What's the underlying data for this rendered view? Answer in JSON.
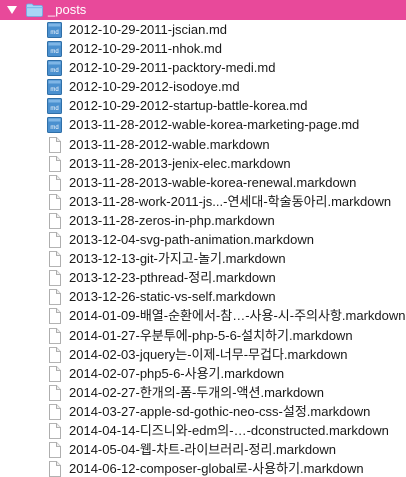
{
  "folder": {
    "name": "_posts",
    "expanded": true,
    "selection_color": "#e8499a"
  },
  "files": [
    {
      "name": "2012-10-29-2011-jscian.md",
      "icon": "markdown-file-icon"
    },
    {
      "name": "2012-10-29-2011-nhok.md",
      "icon": "markdown-file-icon"
    },
    {
      "name": "2012-10-29-2011-packtory-medi.md",
      "icon": "markdown-file-icon"
    },
    {
      "name": "2012-10-29-2012-isodoye.md",
      "icon": "markdown-file-icon"
    },
    {
      "name": "2012-10-29-2012-startup-battle-korea.md",
      "icon": "markdown-file-icon"
    },
    {
      "name": "2013-11-28-2012-wable-korea-marketing-page.md",
      "icon": "markdown-file-icon"
    },
    {
      "name": "2013-11-28-2012-wable.markdown",
      "icon": "document-icon"
    },
    {
      "name": "2013-11-28-2013-jenix-elec.markdown",
      "icon": "document-icon"
    },
    {
      "name": "2013-11-28-2013-wable-korea-renewal.markdown",
      "icon": "document-icon"
    },
    {
      "name": "2013-11-28-work-2011-js...-연세대-학술동아리.markdown",
      "icon": "document-icon"
    },
    {
      "name": "2013-11-28-zeros-in-php.markdown",
      "icon": "document-icon"
    },
    {
      "name": "2013-12-04-svg-path-animation.markdown",
      "icon": "document-icon"
    },
    {
      "name": "2013-12-13-git-가지고-놀기.markdown",
      "icon": "document-icon"
    },
    {
      "name": "2013-12-23-pthread-정리.markdown",
      "icon": "document-icon"
    },
    {
      "name": "2013-12-26-static-vs-self.markdown",
      "icon": "document-icon"
    },
    {
      "name": "2014-01-09-배열-순환에서-참…-사용-시-주의사항.markdown",
      "icon": "document-icon"
    },
    {
      "name": "2014-01-27-우분투에-php-5-6-설치하기.markdown",
      "icon": "document-icon"
    },
    {
      "name": "2014-02-03-jquery는-이제-너무-무겁다.markdown",
      "icon": "document-icon"
    },
    {
      "name": "2014-02-07-php5-6-사용기.markdown",
      "icon": "document-icon"
    },
    {
      "name": "2014-02-27-한개의-폼-두개의-액션.markdown",
      "icon": "document-icon"
    },
    {
      "name": "2014-03-27-apple-sd-gothic-neo-css-설정.markdown",
      "icon": "document-icon"
    },
    {
      "name": "2014-04-14-디즈니와-edm의-…-dconstructed.markdown",
      "icon": "document-icon"
    },
    {
      "name": "2014-05-04-웹-차트-라이브러리-정리.markdown",
      "icon": "document-icon"
    },
    {
      "name": "2014-06-12-composer-global로-사용하기.markdown",
      "icon": "document-icon"
    }
  ]
}
